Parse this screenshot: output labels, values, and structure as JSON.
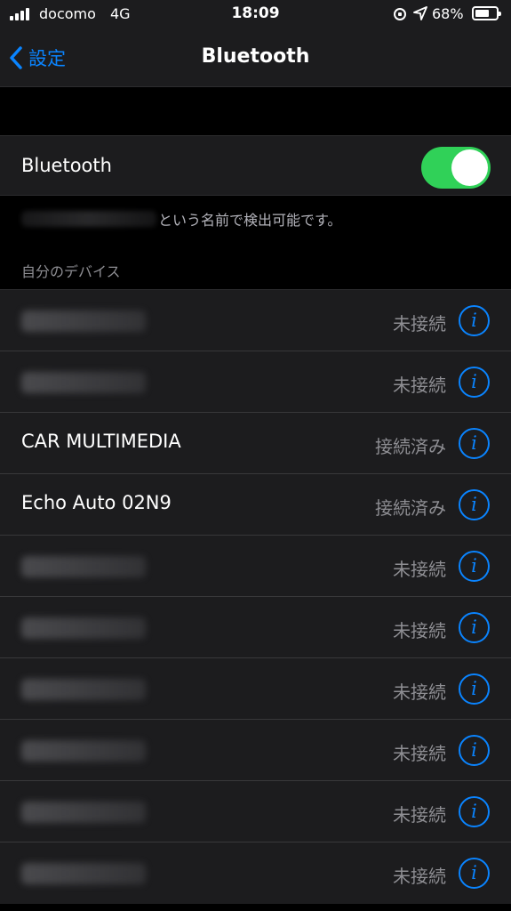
{
  "status_bar": {
    "carrier": "docomo",
    "network": "4G",
    "time": "18:09",
    "battery_percent": "68%",
    "battery_level": 0.68,
    "icons": [
      "signal-icon",
      "orientation-lock-icon",
      "location-icon",
      "battery-icon"
    ]
  },
  "nav": {
    "back_label": "設定",
    "title": "Bluetooth"
  },
  "bluetooth_toggle": {
    "label": "Bluetooth",
    "on": true,
    "on_color": "#30d158"
  },
  "discoverable_text": "という名前で検出可能です。",
  "section_header": "自分のデバイス",
  "devices": [
    {
      "name": "",
      "status": "未接続"
    },
    {
      "name": "",
      "status": "未接続"
    },
    {
      "name": "CAR MULTIMEDIA",
      "status": "接続済み"
    },
    {
      "name": "Echo Auto 02N9",
      "status": "接続済み"
    },
    {
      "name": "",
      "status": "未接続"
    },
    {
      "name": "",
      "status": "未接続"
    },
    {
      "name": "",
      "status": "未接続"
    },
    {
      "name": "",
      "status": "未接続"
    },
    {
      "name": "",
      "status": "未接続"
    },
    {
      "name": "",
      "status": "未接続"
    }
  ],
  "info_icon_glyph": "i",
  "colors": {
    "accent": "#0a84ff",
    "background": "#000000",
    "cell": "#1c1c1e",
    "secondary_text": "#8e8e93"
  }
}
